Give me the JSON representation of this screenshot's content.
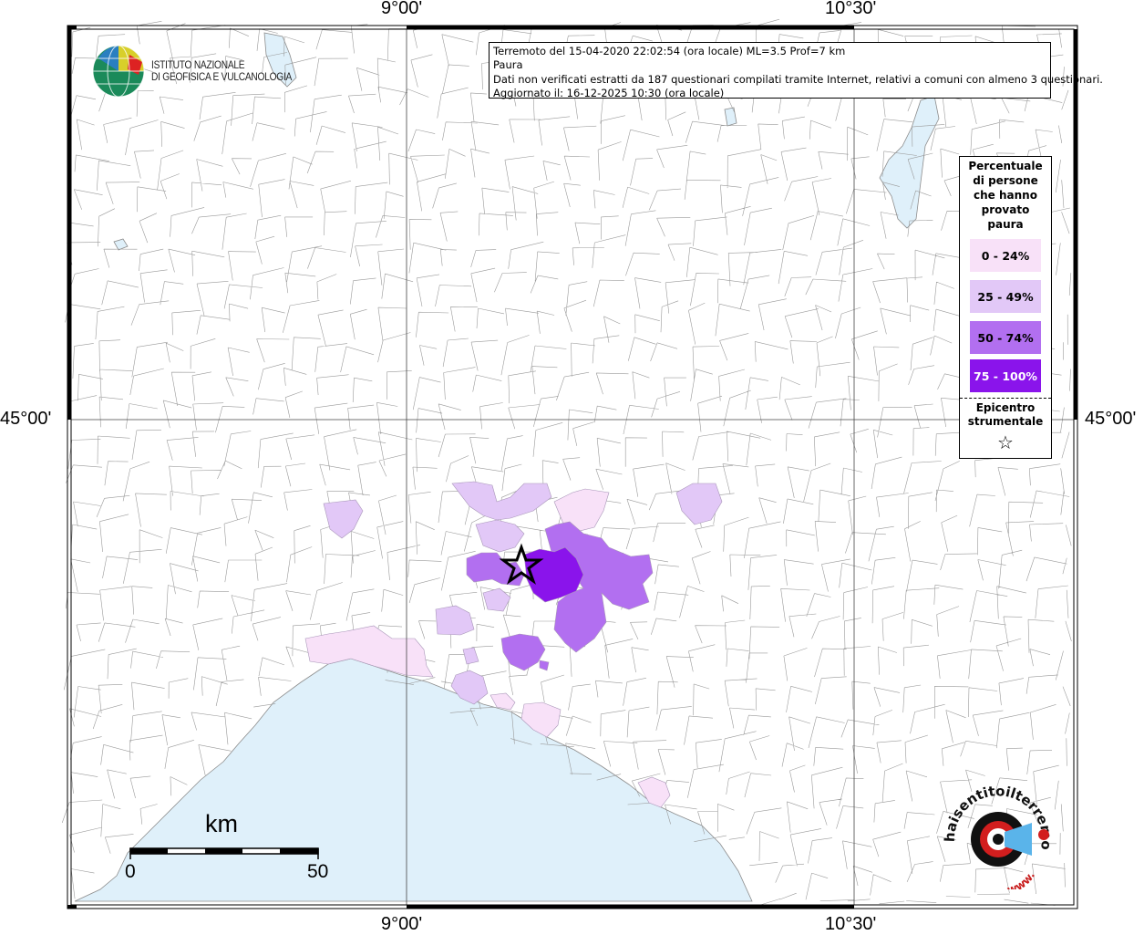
{
  "axes": {
    "top": [
      "9°00'",
      "10°30'"
    ],
    "bottom": [
      "9°00'",
      "10°30'"
    ],
    "left": [
      "45°00'"
    ],
    "right": [
      "45°00'"
    ]
  },
  "info": {
    "line1": "Terremoto del 15-04-2020 22:02:54 (ora locale) ML=3.5 Prof=7 km",
    "line2": "Paura",
    "line3": "Dati non verificati estratti da 187 questionari compilati tramite Internet, relativi a comuni con almeno 3 questionari.",
    "line4": "Aggiornato il: 16-12-2025 10:30 (ora locale)"
  },
  "legend": {
    "title": [
      "Percentuale",
      "di persone",
      "che hanno",
      "provato",
      "paura"
    ],
    "classes": [
      {
        "label": "0 - 24%",
        "color": "#f8e1f8",
        "text_color": "#000000"
      },
      {
        "label": "25 - 49%",
        "color": "#e2c8f7",
        "text_color": "#000000"
      },
      {
        "label": "50 - 74%",
        "color": "#b26ff0",
        "text_color": "#000000"
      },
      {
        "label": "75 - 100%",
        "color": "#8a14eb",
        "text_color": "#ffffff"
      }
    ],
    "epicenter_title": [
      "Epicentro",
      "strumentale"
    ],
    "epicenter_symbol": "☆"
  },
  "institute": {
    "line1": "ISTITUTO NAZIONALE",
    "line2": "DI GEOFISICA E VULCANOLOGIA"
  },
  "scale": {
    "unit": "km",
    "start": "0",
    "end": "50"
  },
  "website": {
    "name": "haisentitoilterremoto.it",
    "prefix": "www."
  },
  "colors": {
    "sea": "#dff0fa",
    "border": "#8c8c8c",
    "frame": "#000000"
  }
}
